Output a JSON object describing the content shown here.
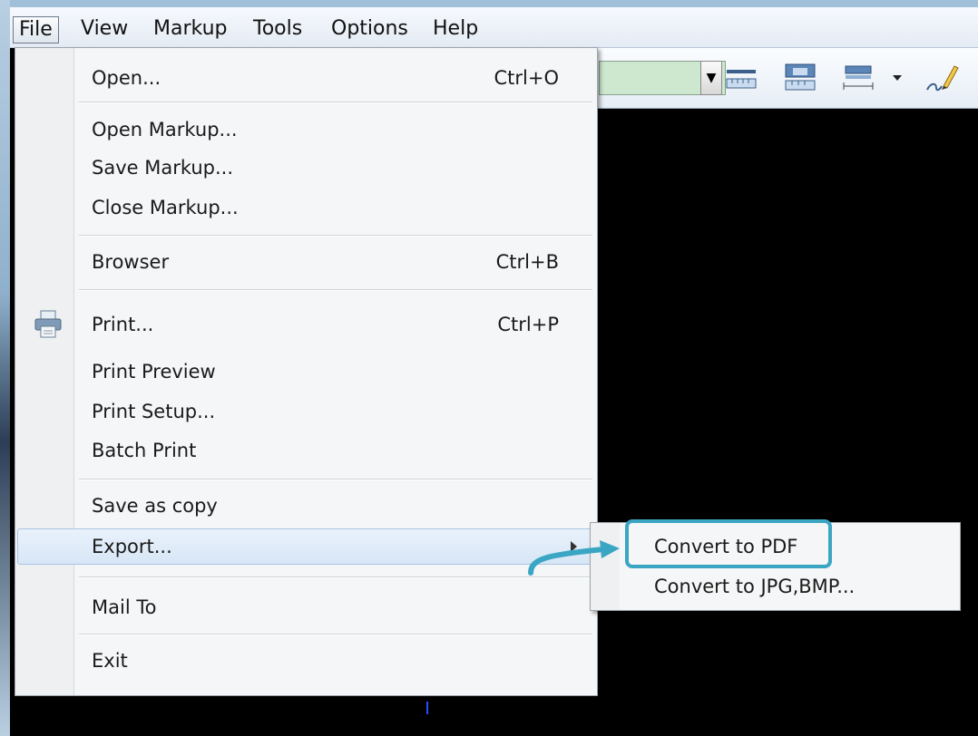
{
  "menubar": {
    "items": [
      {
        "label": "File",
        "active": true
      },
      {
        "label": "View"
      },
      {
        "label": "Markup"
      },
      {
        "label": "Tools"
      },
      {
        "label": "Options"
      },
      {
        "label": "Help"
      }
    ]
  },
  "file_menu": {
    "items": [
      {
        "label": "Open...",
        "shortcut": "Ctrl+O"
      },
      {
        "label": "Open Markup..."
      },
      {
        "label": "Save Markup..."
      },
      {
        "label": "Close Markup..."
      },
      {
        "label": "Browser",
        "shortcut": "Ctrl+B"
      },
      {
        "label": "Print...",
        "shortcut": "Ctrl+P",
        "icon": "printer-icon"
      },
      {
        "label": "Print Preview"
      },
      {
        "label": "Print Setup..."
      },
      {
        "label": "Batch Print"
      },
      {
        "label": "Save as copy"
      },
      {
        "label": "Export...",
        "submenu": true,
        "highlighted": true
      },
      {
        "label": "Mail To"
      },
      {
        "label": "Exit"
      }
    ]
  },
  "export_submenu": {
    "items": [
      {
        "label": "Convert to PDF",
        "emphasized": true
      },
      {
        "label": "Convert to JPG,BMP..."
      }
    ]
  },
  "toolbar": {
    "icons": [
      "ruler-icon",
      "area-ruler-icon",
      "dimension-icon",
      "dropdown-arrow-icon",
      "pen-icon"
    ]
  },
  "colors": {
    "accent": "#3aa6c4",
    "combo_bg": "#cde8cf",
    "canvas": "#000000"
  }
}
